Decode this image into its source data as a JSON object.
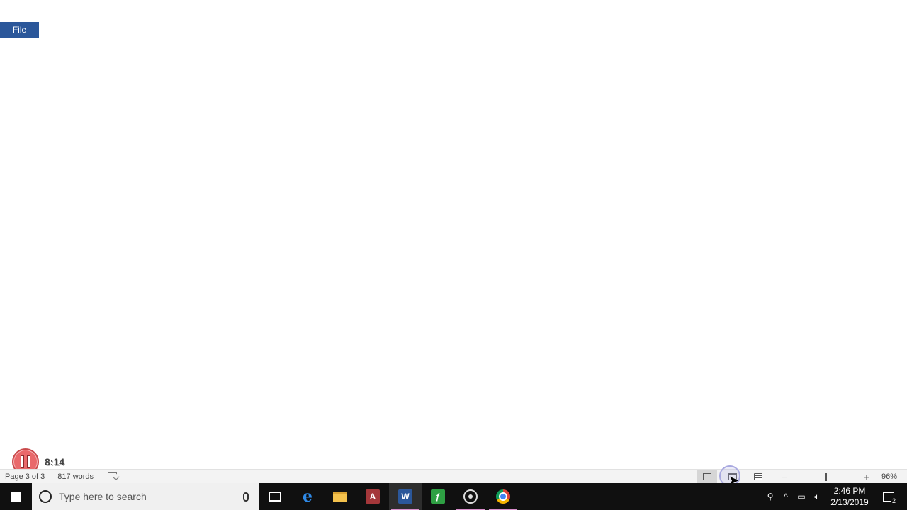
{
  "ribbon": {
    "file_tab": "File"
  },
  "recorder": {
    "time": "8:14"
  },
  "status_bar": {
    "page_info": "Page 3 of 3",
    "word_count": "817 words",
    "zoom_level": "96%",
    "zoom_fraction": 0.5
  },
  "taskbar": {
    "search_placeholder": "Type here to search",
    "clock_time": "2:46 PM",
    "clock_date": "2/13/2019",
    "notification_count": "2",
    "apps": [
      {
        "icon": "task-view-icon"
      },
      {
        "icon": "edge-icon"
      },
      {
        "icon": "file-explorer-icon"
      },
      {
        "icon": "access-icon",
        "label": "A"
      },
      {
        "icon": "word-icon",
        "label": "W"
      },
      {
        "icon": "green-app-icon"
      },
      {
        "icon": "media-app-icon"
      },
      {
        "icon": "chrome-icon"
      }
    ]
  },
  "colors": {
    "word_blue": "#2b579a",
    "taskbar_bg": "#101010",
    "running_indicator": "#d88ecb"
  }
}
